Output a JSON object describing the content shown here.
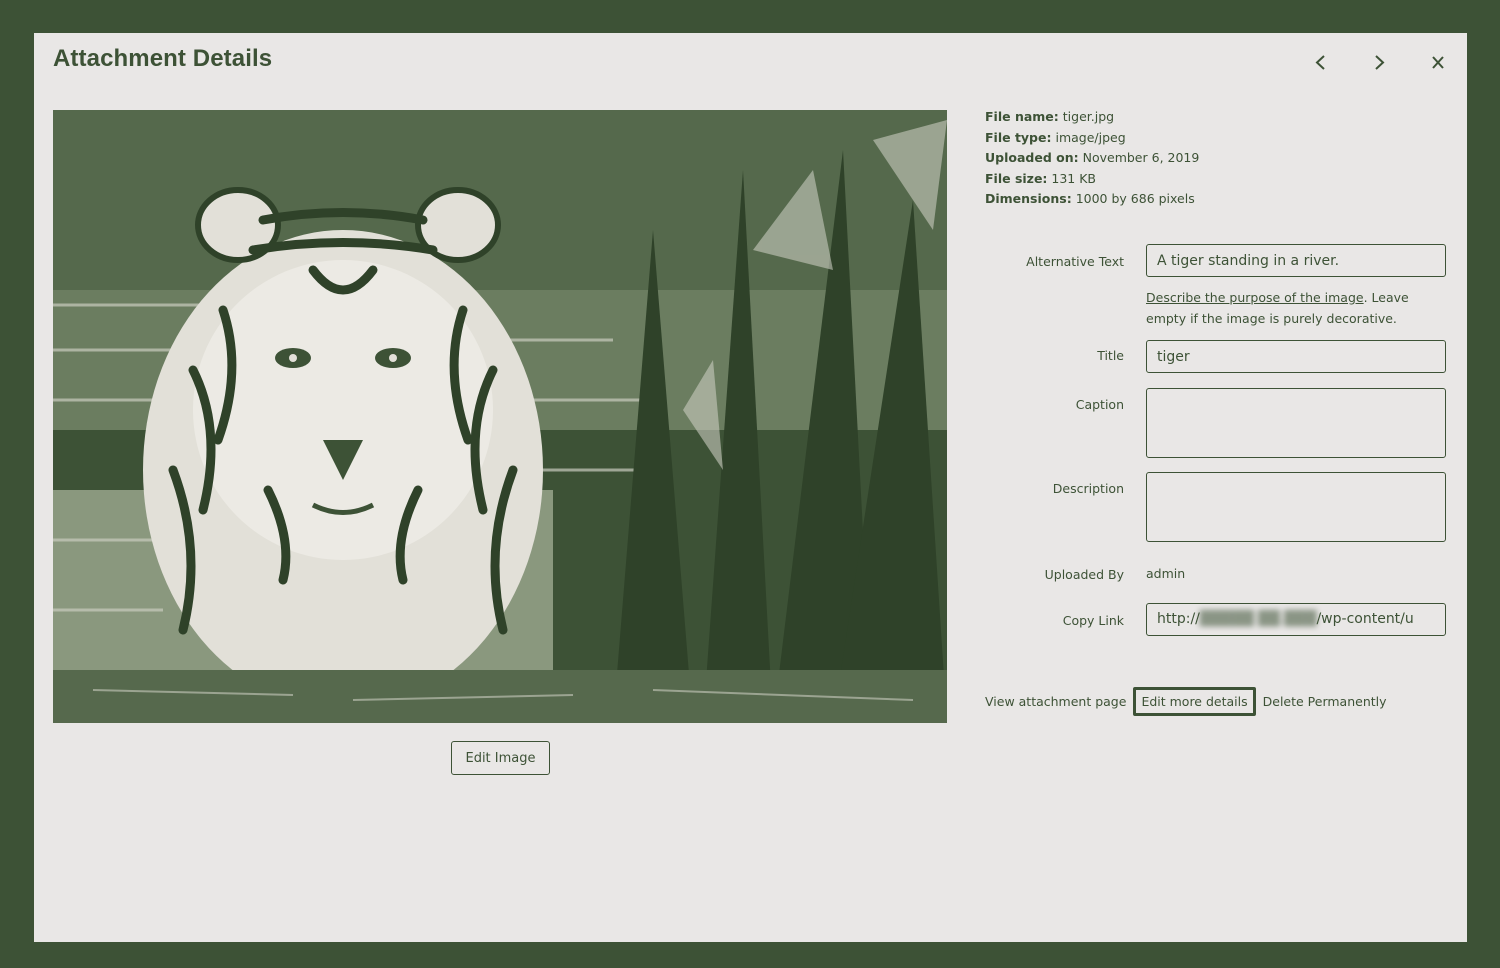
{
  "modal": {
    "title": "Attachment Details",
    "prev_icon": "chevron-left-icon",
    "next_icon": "chevron-right-icon",
    "close_icon": "close-icon"
  },
  "image": {
    "subject": "tiger-photo",
    "edit_button": "Edit Image"
  },
  "file_info": [
    {
      "label": "File name:",
      "value": "tiger.jpg"
    },
    {
      "label": "File type:",
      "value": "image/jpeg"
    },
    {
      "label": "Uploaded on:",
      "value": "November 6, 2019"
    },
    {
      "label": "File size:",
      "value": "131 KB"
    },
    {
      "label": "Dimensions:",
      "value": "1000 by 686 pixels"
    }
  ],
  "fields": {
    "alt_text": {
      "label": "Alternative Text",
      "value": "A tiger standing in a river."
    },
    "alt_help": {
      "link": "Describe the purpose of the image",
      "rest": ". Leave empty if the image is purely decorative."
    },
    "title": {
      "label": "Title",
      "value": "tiger"
    },
    "caption": {
      "label": "Caption",
      "value": ""
    },
    "description": {
      "label": "Description",
      "value": ""
    },
    "uploaded_by": {
      "label": "Uploaded By",
      "value": "admin"
    },
    "copy_link": {
      "label": "Copy Link",
      "prefix": "http://",
      "suffix": "/wp-content/u"
    }
  },
  "actions": {
    "view": "View attachment page",
    "edit_more": "Edit more details",
    "delete": "Delete Permanently"
  },
  "colors": {
    "dark": "#3d5236",
    "light": "#e9e7e6"
  }
}
